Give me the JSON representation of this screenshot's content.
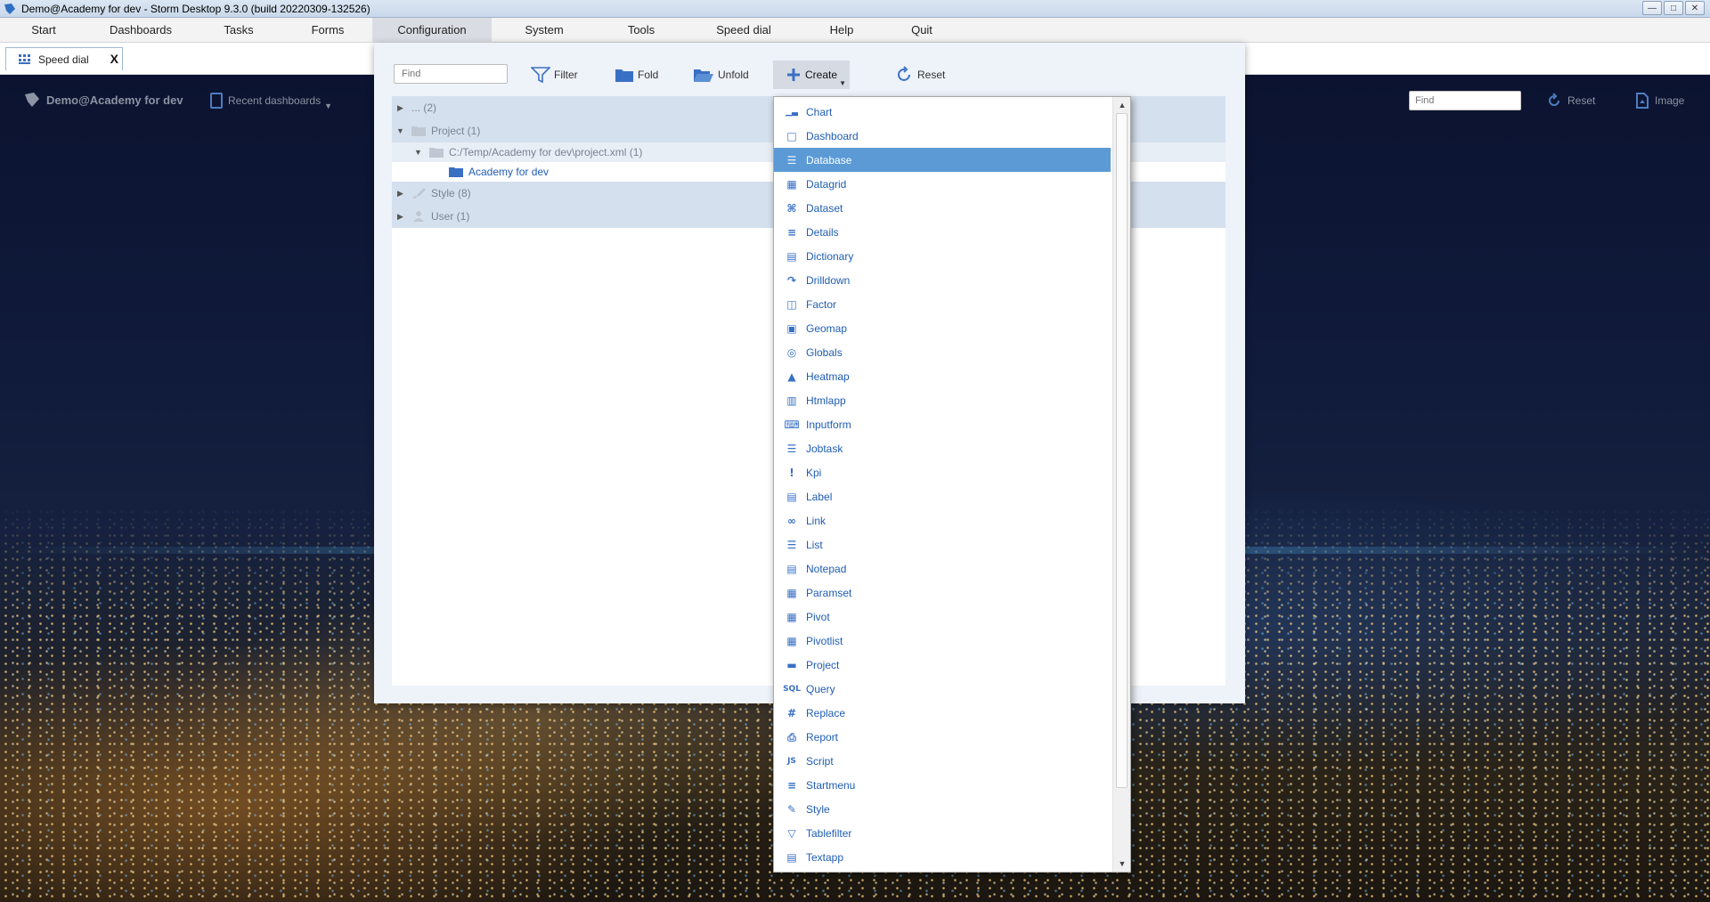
{
  "window": {
    "title": "Demo@Academy for dev -  Storm Desktop 9.3.0 (build 20220309-132526)"
  },
  "menu": {
    "items": [
      {
        "label": "Start"
      },
      {
        "label": "Dashboards"
      },
      {
        "label": "Tasks"
      },
      {
        "label": "Forms"
      },
      {
        "label": "Configuration"
      },
      {
        "label": "System"
      },
      {
        "label": "Tools"
      },
      {
        "label": "Speed dial"
      },
      {
        "label": "Help"
      },
      {
        "label": "Quit"
      }
    ],
    "active": "Configuration"
  },
  "tabs": [
    {
      "label": "Speed dial",
      "close": "X"
    }
  ],
  "dashboard": {
    "user": "Demo@Academy for dev",
    "recent": "Recent dashboards",
    "find_placeholder": "Find",
    "reset": "Reset",
    "image": "Image"
  },
  "config": {
    "find_placeholder": "Find",
    "toolbar": {
      "filter": "Filter",
      "fold": "Fold",
      "unfold": "Unfold",
      "create": "Create",
      "reset": "Reset"
    },
    "tree": [
      {
        "label": "... (2)"
      },
      {
        "label": "Project (1)"
      },
      {
        "label": "C:/Temp/Academy for dev\\project.xml (1)"
      },
      {
        "label": "Academy for dev"
      },
      {
        "label": "Style (8)"
      },
      {
        "label": "User (1)"
      }
    ]
  },
  "create_menu": {
    "selected": "Database",
    "items": [
      {
        "label": "Chart",
        "icon": "chart-icon"
      },
      {
        "label": "Dashboard",
        "icon": "dashboard-icon"
      },
      {
        "label": "Database",
        "icon": "database-icon"
      },
      {
        "label": "Datagrid",
        "icon": "datagrid-icon"
      },
      {
        "label": "Dataset",
        "icon": "dataset-icon"
      },
      {
        "label": "Details",
        "icon": "details-icon"
      },
      {
        "label": "Dictionary",
        "icon": "dictionary-icon"
      },
      {
        "label": "Drilldown",
        "icon": "drilldown-icon"
      },
      {
        "label": "Factor",
        "icon": "factor-icon"
      },
      {
        "label": "Geomap",
        "icon": "geomap-icon"
      },
      {
        "label": "Globals",
        "icon": "globals-icon"
      },
      {
        "label": "Heatmap",
        "icon": "heatmap-icon"
      },
      {
        "label": "Htmlapp",
        "icon": "htmlapp-icon"
      },
      {
        "label": "Inputform",
        "icon": "inputform-icon"
      },
      {
        "label": "Jobtask",
        "icon": "jobtask-icon"
      },
      {
        "label": "Kpi",
        "icon": "kpi-icon"
      },
      {
        "label": "Label",
        "icon": "label-icon"
      },
      {
        "label": "Link",
        "icon": "link-icon"
      },
      {
        "label": "List",
        "icon": "list-icon"
      },
      {
        "label": "Notepad",
        "icon": "notepad-icon"
      },
      {
        "label": "Paramset",
        "icon": "paramset-icon"
      },
      {
        "label": "Pivot",
        "icon": "pivot-icon"
      },
      {
        "label": "Pivotlist",
        "icon": "pivotlist-icon"
      },
      {
        "label": "Project",
        "icon": "project-icon"
      },
      {
        "label": "Query",
        "icon": "query-icon"
      },
      {
        "label": "Replace",
        "icon": "replace-icon"
      },
      {
        "label": "Report",
        "icon": "report-icon"
      },
      {
        "label": "Script",
        "icon": "script-icon"
      },
      {
        "label": "Startmenu",
        "icon": "startmenu-icon"
      },
      {
        "label": "Style",
        "icon": "style-icon"
      },
      {
        "label": "Tablefilter",
        "icon": "tablefilter-icon"
      },
      {
        "label": "Textapp",
        "icon": "textapp-icon"
      }
    ]
  },
  "colors": {
    "accent": "#3a70c4",
    "selection": "#5b9ad5",
    "link": "#1f5db4"
  }
}
